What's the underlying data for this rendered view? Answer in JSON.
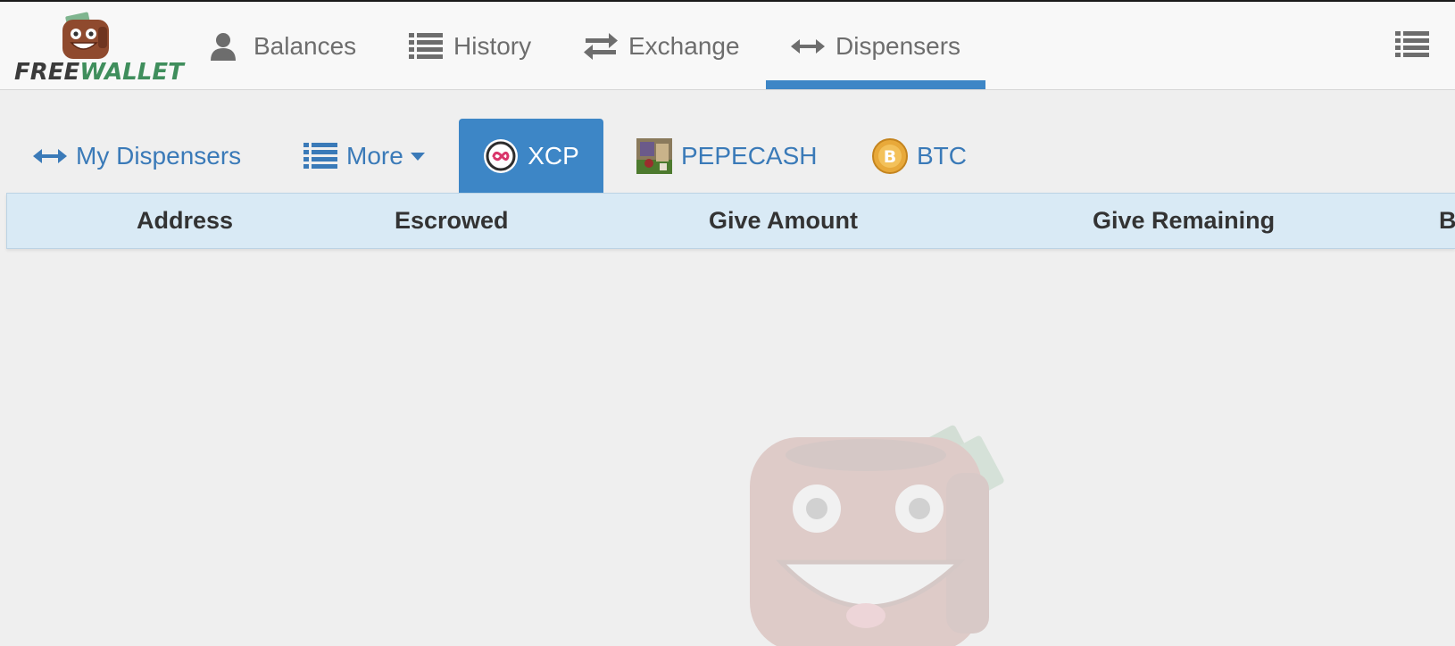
{
  "app": {
    "logo_free": "FREE",
    "logo_wallet": "WALLET"
  },
  "nav": {
    "items": [
      {
        "label": "Balances",
        "icon": "user-icon"
      },
      {
        "label": "History",
        "icon": "list-icon"
      },
      {
        "label": "Exchange",
        "icon": "exchange-icon"
      },
      {
        "label": "Dispensers",
        "icon": "arrows-horizontal-icon",
        "active": true
      }
    ],
    "menu_icon": "menu-list-icon"
  },
  "subtabs": [
    {
      "label": "My Dispensers",
      "icon": "arrows-horizontal-icon"
    },
    {
      "label": "More",
      "icon": "list-icon",
      "dropdown": true
    },
    {
      "label": "XCP",
      "icon": "xcp-token-icon",
      "active": true
    },
    {
      "label": "PEPECASH",
      "icon": "pepecash-token-icon"
    },
    {
      "label": "BTC",
      "icon": "bitcoin-icon"
    }
  ],
  "table": {
    "columns": [
      "Address",
      "Escrowed",
      "Give Amount",
      "Give Remaining",
      "B"
    ]
  },
  "colors": {
    "accent": "#3d86c6",
    "link": "#3a7ab8",
    "header_bg": "#d9eaf5",
    "page_bg": "#efefef",
    "logo_green": "#3f8e5c"
  }
}
